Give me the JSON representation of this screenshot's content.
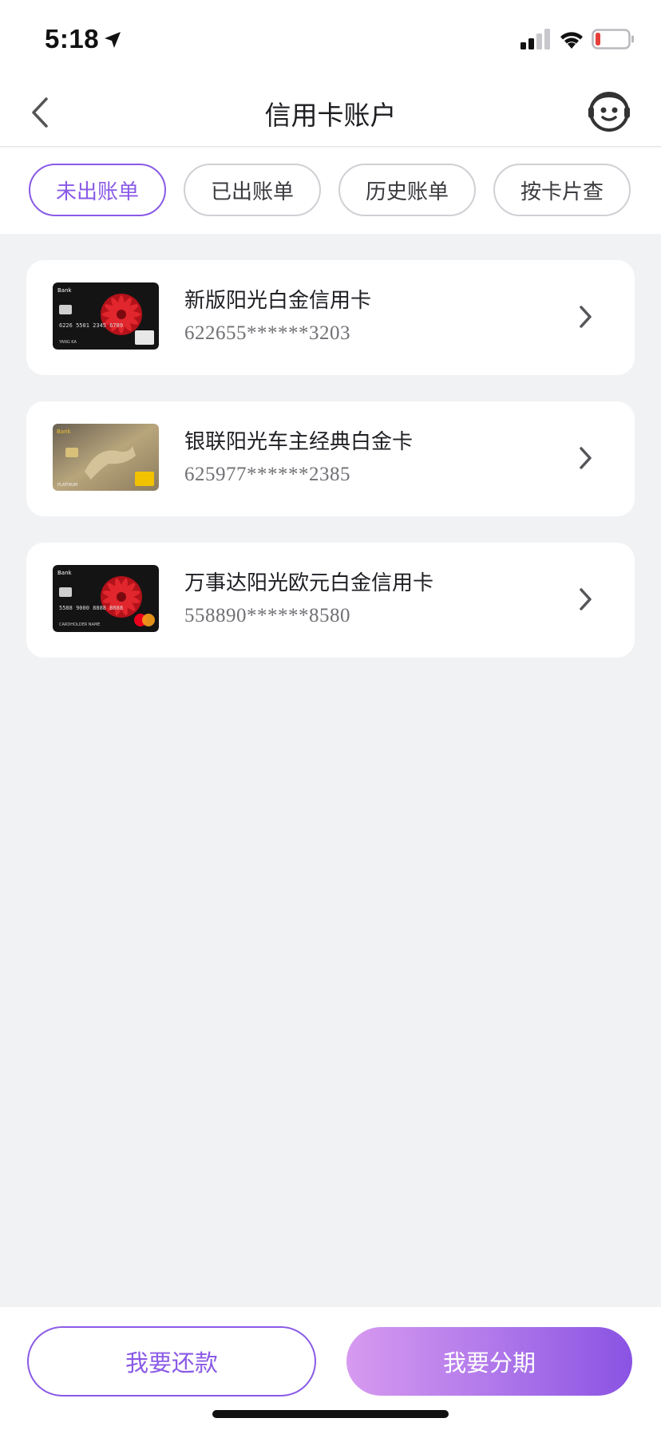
{
  "status_bar": {
    "time": "5:18",
    "icons": [
      "location-arrow-icon",
      "cellular-signal-icon",
      "wifi-icon",
      "battery-low-icon"
    ],
    "battery_color": "#e5413a"
  },
  "nav": {
    "title": "信用卡账户",
    "back_icon": "chevron-left-icon",
    "service_icon": "customer-service-robot-icon"
  },
  "tabs": [
    {
      "label": "未出账单",
      "active": true
    },
    {
      "label": "已出账单",
      "active": false
    },
    {
      "label": "历史账单",
      "active": false
    },
    {
      "label": "按卡片查",
      "active": false
    }
  ],
  "cards": [
    {
      "name": "新版阳光白金信用卡",
      "number": "622655******3203",
      "image": "card-red-flower-unionpay",
      "image_text": "YANG KA"
    },
    {
      "name": "银联阳光车主经典白金卡",
      "number": "625977******2385",
      "image": "card-gold-horse-unionpay",
      "image_text": "PLATINUM"
    },
    {
      "name": "万事达阳光欧元白金信用卡",
      "number": "558890******8580",
      "image": "card-red-flower-mastercard",
      "image_text": "CARDHOLDER NAME"
    }
  ],
  "actions": {
    "repay_label": "我要还款",
    "installment_label": "我要分期"
  },
  "colors": {
    "accent": "#8a5ae6",
    "gradient_start": "#d79af0",
    "gradient_end": "#8a53e3",
    "page_bg": "#f1f2f4"
  }
}
